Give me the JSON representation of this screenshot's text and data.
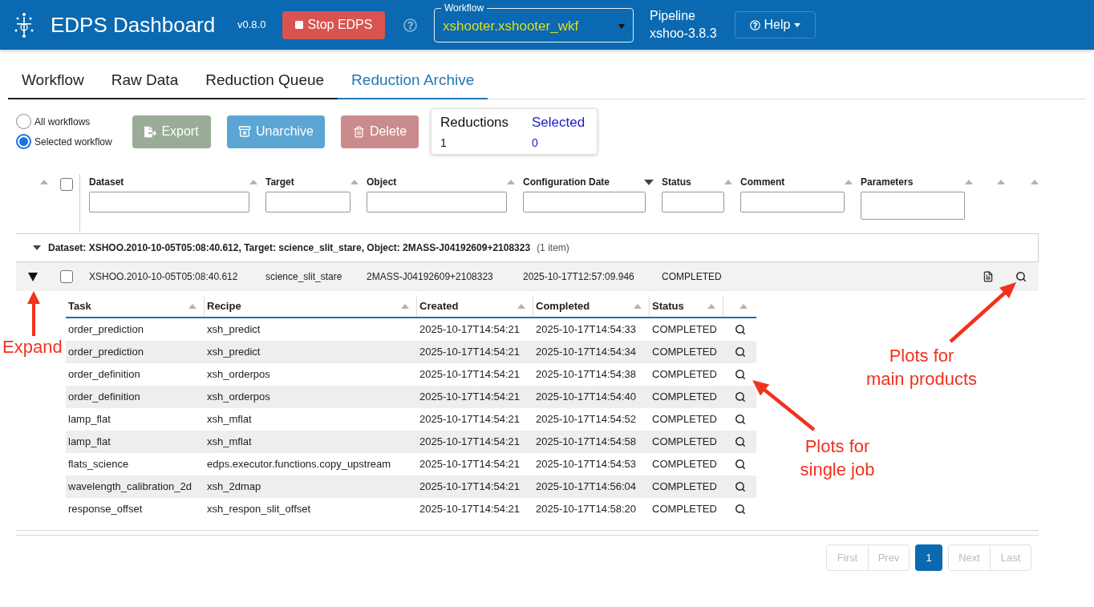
{
  "header": {
    "title": "EDPS Dashboard",
    "version": "v0.8.0",
    "stop_button": "Stop EDPS",
    "workflow": {
      "label": "Workflow",
      "value": "xshooter.xshooter_wkf"
    },
    "pipeline": {
      "label": "Pipeline",
      "version": "xshoo-3.8.3"
    },
    "help_button": "Help"
  },
  "tabs": [
    {
      "label": "Workflow",
      "selected": false
    },
    {
      "label": "Raw Data",
      "selected": false
    },
    {
      "label": "Reduction Queue",
      "selected": false
    },
    {
      "label": "Reduction Archive",
      "selected": true
    }
  ],
  "scope_options": [
    {
      "label": "All workflows",
      "selected": false
    },
    {
      "label": "Selected workflow",
      "selected": true
    }
  ],
  "actions": [
    {
      "kind": "export",
      "label": "Export",
      "disabled": true
    },
    {
      "kind": "unarchive",
      "label": "Unarchive",
      "disabled": true
    },
    {
      "kind": "delete",
      "label": "Delete",
      "disabled": true
    }
  ],
  "summary": {
    "reductions": {
      "label": "Reductions",
      "value": "1"
    },
    "selected": {
      "label": "Selected",
      "value": "0"
    }
  },
  "table": {
    "select_all": {
      "checked": false
    },
    "columns": [
      {
        "label": "Dataset",
        "sorted": false,
        "kind": "text"
      },
      {
        "label": "Target",
        "sorted": false,
        "kind": "text"
      },
      {
        "label": "Object",
        "sorted": false,
        "kind": "text"
      },
      {
        "label": "Configuration Date",
        "sorted": true,
        "kind": "text"
      },
      {
        "label": "Status",
        "sorted": false,
        "kind": "text"
      },
      {
        "label": "Comment",
        "sorted": false,
        "kind": "text"
      },
      {
        "label": "Parameters",
        "sorted": false,
        "kind": "multiline"
      }
    ],
    "group": {
      "label": "Dataset: XSHOO.2010-10-05T05:08:40.612, Target: science_slit_stare, Object: 2MASS-J04192609+2108323",
      "count": "(1 item)",
      "expanded": true
    },
    "rows": [
      {
        "cells": [
          "XSHOO.2010-10-05T05:08:40.612",
          "science_slit_stare",
          "2MASS-J04192609+2108323",
          "2025-10-17T12:57:09.946",
          "COMPLETED"
        ],
        "expanded": true,
        "checked": false,
        "jobs": {
          "columns": [
            "Task",
            "Recipe",
            "Created",
            "Completed",
            "Status"
          ],
          "rows": [
            [
              "order_prediction",
              "xsh_predict",
              "2025-10-17T14:54:21",
              "2025-10-17T14:54:33",
              "COMPLETED"
            ],
            [
              "order_prediction",
              "xsh_predict",
              "2025-10-17T14:54:21",
              "2025-10-17T14:54:34",
              "COMPLETED"
            ],
            [
              "order_definition",
              "xsh_orderpos",
              "2025-10-17T14:54:21",
              "2025-10-17T14:54:38",
              "COMPLETED"
            ],
            [
              "order_definition",
              "xsh_orderpos",
              "2025-10-17T14:54:21",
              "2025-10-17T14:54:40",
              "COMPLETED"
            ],
            [
              "lamp_flat",
              "xsh_mflat",
              "2025-10-17T14:54:21",
              "2025-10-17T14:54:52",
              "COMPLETED"
            ],
            [
              "lamp_flat",
              "xsh_mflat",
              "2025-10-17T14:54:21",
              "2025-10-17T14:54:58",
              "COMPLETED"
            ],
            [
              "flats_science",
              "edps.executor.functions.copy_upstream",
              "2025-10-17T14:54:21",
              "2025-10-17T14:54:53",
              "COMPLETED"
            ],
            [
              "wavelength_calibration_2d",
              "xsh_2dmap",
              "2025-10-17T14:54:21",
              "2025-10-17T14:56:04",
              "COMPLETED"
            ],
            [
              "response_offset",
              "xsh_respon_slit_offset",
              "2025-10-17T14:54:21",
              "2025-10-17T14:58:20",
              "COMPLETED"
            ]
          ]
        }
      }
    ]
  },
  "pagination": {
    "nav_before": [
      {
        "label": "First",
        "disabled": true
      },
      {
        "label": "Prev",
        "disabled": true
      }
    ],
    "pages": [
      {
        "label": "1",
        "selected": true
      }
    ],
    "nav_after": [
      {
        "label": "Next",
        "disabled": true
      },
      {
        "label": "Last",
        "disabled": true
      }
    ]
  },
  "annotations": [
    {
      "text": "Expand"
    },
    {
      "text": "Plots for\nmain products"
    },
    {
      "text": "Plots for\nsingle job"
    }
  ]
}
